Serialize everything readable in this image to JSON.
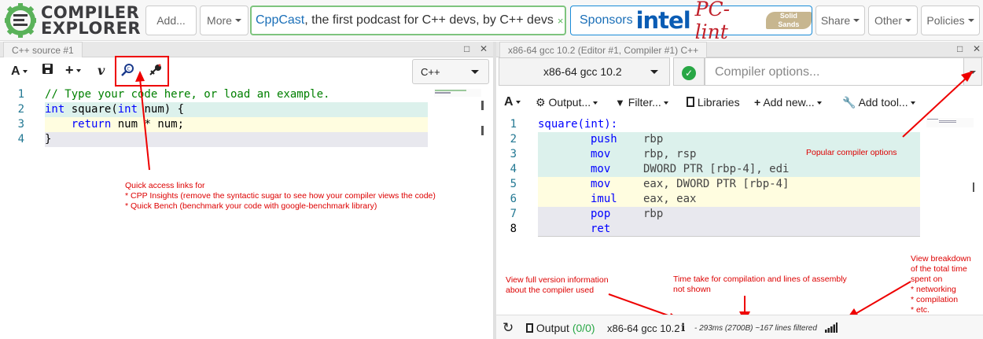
{
  "navbar": {
    "logo_line1": "COMPILER",
    "logo_line2": "EXPLORER",
    "add_label": "Add...",
    "more_label": "More",
    "cppcast_link": "CppCast",
    "cppcast_text": ", the first podcast for C++ devs, by C++ devs",
    "cppcast_close": "×",
    "sponsors_label": "Sponsors",
    "sponsor_intel": "intel",
    "sponsor_pclint": "PC-lint",
    "sponsor_solid": "Solid Sands",
    "share_label": "Share",
    "other_label": "Other",
    "policies_label": "Policies"
  },
  "editor": {
    "tab_title": "C++ source #1",
    "language": "C++",
    "lines": [
      {
        "n": "1",
        "text": "// Type your code here, or load an example."
      },
      {
        "n": "2",
        "text": "int square(int num) {"
      },
      {
        "n": "3",
        "text": "    return num * num;"
      },
      {
        "n": "4",
        "text": "}"
      }
    ],
    "line_highlight_colors": [
      "#ffffff",
      "#dcf1ec",
      "#fffde0",
      "#e8e8ee"
    ]
  },
  "compiler": {
    "tab_title": "x86-64 gcc 10.2 (Editor #1, Compiler #1) C++",
    "selected": "x86-64 gcc 10.2",
    "options_placeholder": "Compiler options...",
    "toolbar": {
      "output": "Output...",
      "filter": "Filter...",
      "libraries": "Libraries",
      "add_new": "Add new...",
      "add_tool": "Add tool..."
    },
    "asm_lines": [
      {
        "n": "1",
        "label": "square(int):",
        "ins": "",
        "ops": ""
      },
      {
        "n": "2",
        "label": "",
        "ins": "push",
        "ops": "rbp"
      },
      {
        "n": "3",
        "label": "",
        "ins": "mov",
        "ops": "rbp, rsp"
      },
      {
        "n": "4",
        "label": "",
        "ins": "mov",
        "ops": "DWORD PTR [rbp-4], edi"
      },
      {
        "n": "5",
        "label": "",
        "ins": "mov",
        "ops": "eax, DWORD PTR [rbp-4]"
      },
      {
        "n": "6",
        "label": "",
        "ins": "imul",
        "ops": "eax, eax"
      },
      {
        "n": "7",
        "label": "",
        "ins": "pop",
        "ops": "rbp"
      },
      {
        "n": "8",
        "label": "",
        "ins": "ret",
        "ops": ""
      }
    ],
    "status": {
      "output_label": "Output",
      "output_counts": "(0/0)",
      "compiler_name": "x86-64 gcc 10.2",
      "timing": "- 293ms (2700B) ~167 lines filtered"
    }
  },
  "annotations": {
    "quick_access": "Quick access links for\n* CPP Insights (remove the syntactic sugar to see how your compiler views the code)\n* Quick Bench (benchmark your code with google-benchmark library)",
    "popular_options": "Popular compiler options",
    "version_info": "View full version information\nabout the compiler used",
    "time_taken": "Time take for compilation and lines of assembly\nnot shown",
    "breakdown": "View breakdown\nof the total time\nspent on\n* networking\n* compilation\n* etc."
  },
  "colors": {
    "annotation_red": "#e00000",
    "accent_green": "#28a745",
    "link_blue": "#1a6fb8"
  }
}
